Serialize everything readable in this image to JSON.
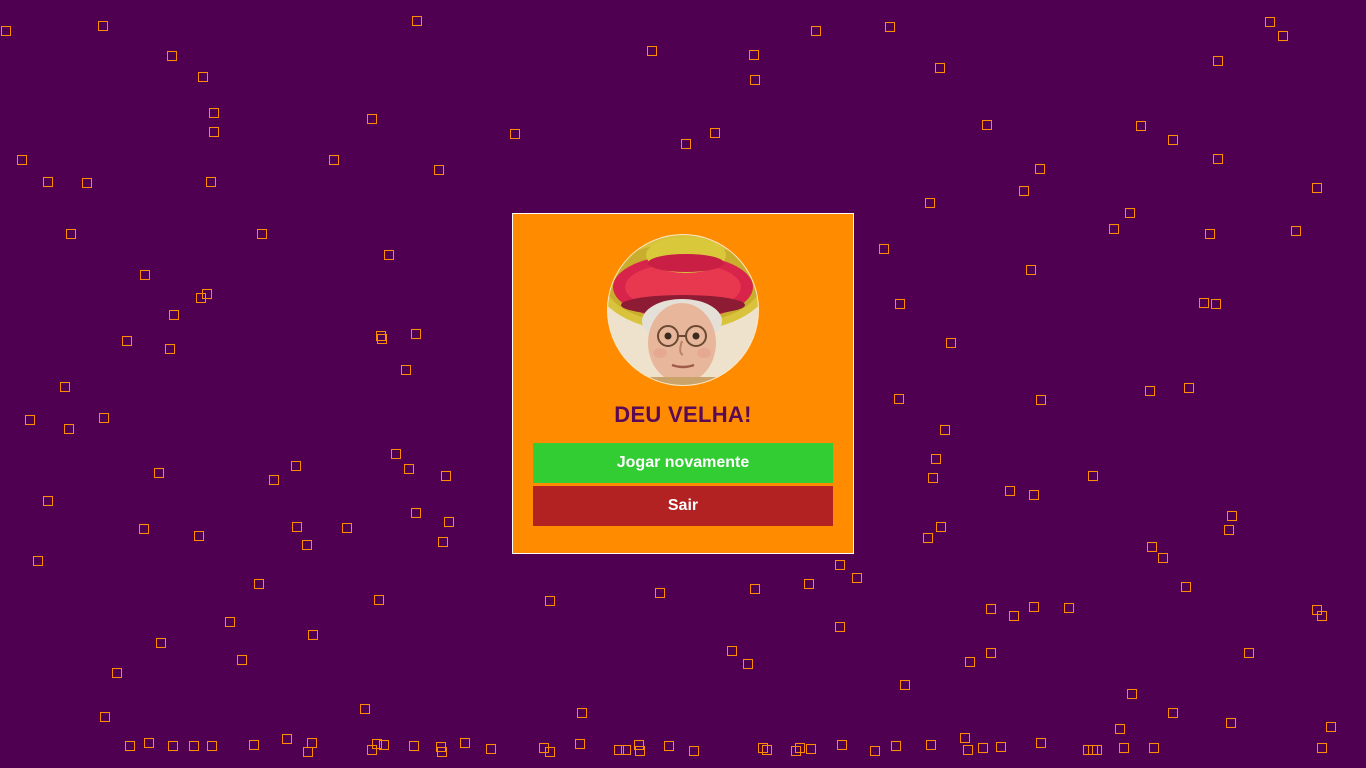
{
  "modal": {
    "title": "DEU VELHA!",
    "play_again_label": "Jogar novamente",
    "exit_label": "Sair",
    "avatar_icon": "old-woman-sombrero-portrait"
  },
  "colors": {
    "background": "#4f0050",
    "panel": "#ff8c00",
    "title": "#5a0a55",
    "play_again": "#32cd32",
    "exit": "#b22222",
    "confetti": "#ff8c00"
  }
}
